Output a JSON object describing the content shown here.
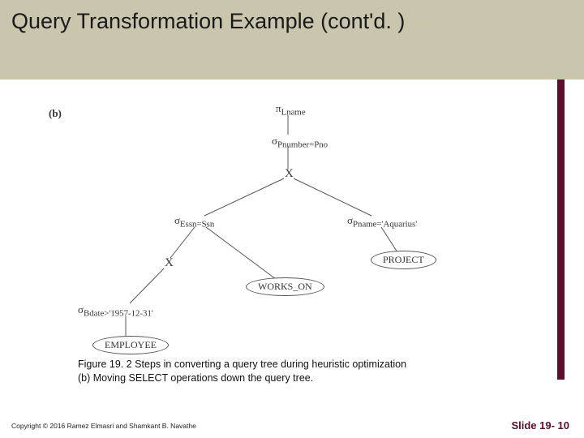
{
  "title": "Query Transformation Example (cont'd. )",
  "figure": {
    "part_label": "(b)",
    "root": {
      "op": "π",
      "expr": "Lname"
    },
    "sel_top": {
      "op": "σ",
      "expr": "Pnumber=Pno"
    },
    "cross1": "X",
    "sel_left": {
      "op": "σ",
      "expr": "Essn=Ssn"
    },
    "sel_right": {
      "op": "σ",
      "expr": "Pname='Aquarius'"
    },
    "rel_project": "PROJECT",
    "cross2": "X",
    "rel_works_on": "WORKS_ON",
    "sel_bdate": {
      "op": "σ",
      "expr": "Bdate>'1957-12-31'"
    },
    "rel_employee": "EMPLOYEE",
    "caption_line1": "Figure 19. 2 Steps in converting a query tree during heuristic optimization",
    "caption_line2": "(b) Moving SELECT operations down the query tree."
  },
  "footer": {
    "copyright": "Copyright © 2016 Ramez Elmasri and Shamkant B. Navathe",
    "slide_label": "Slide 19- 10"
  }
}
